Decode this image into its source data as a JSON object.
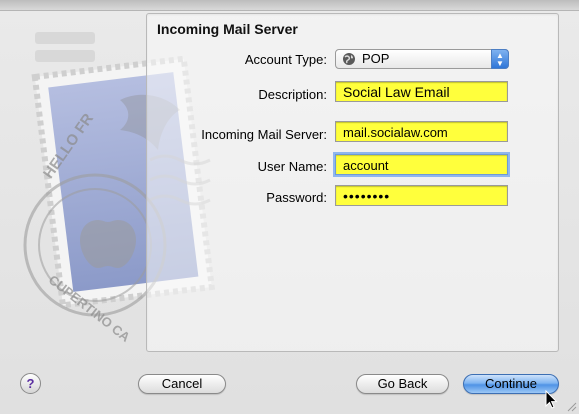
{
  "panel": {
    "title": "Incoming Mail Server"
  },
  "form": {
    "account_type": {
      "label": "Account Type:",
      "value": "POP",
      "icon": "globe-icon"
    },
    "description": {
      "label": "Description:",
      "value": "Social Law Email"
    },
    "incoming_server": {
      "label": "Incoming Mail Server:",
      "value": "mail.socialaw.com"
    },
    "user_name": {
      "label": "User Name:",
      "value": "account"
    },
    "password": {
      "label": "Password:",
      "value": "••••••••"
    }
  },
  "buttons": {
    "help": "?",
    "cancel": "Cancel",
    "go_back": "Go Back",
    "continue": "Continue"
  },
  "stamp": {
    "text_top": "HELLO FR",
    "text_bottom": "CUPERTINO CA"
  },
  "colors": {
    "field_highlight": "#ffff3c",
    "primary_button": "#4f93e6"
  }
}
